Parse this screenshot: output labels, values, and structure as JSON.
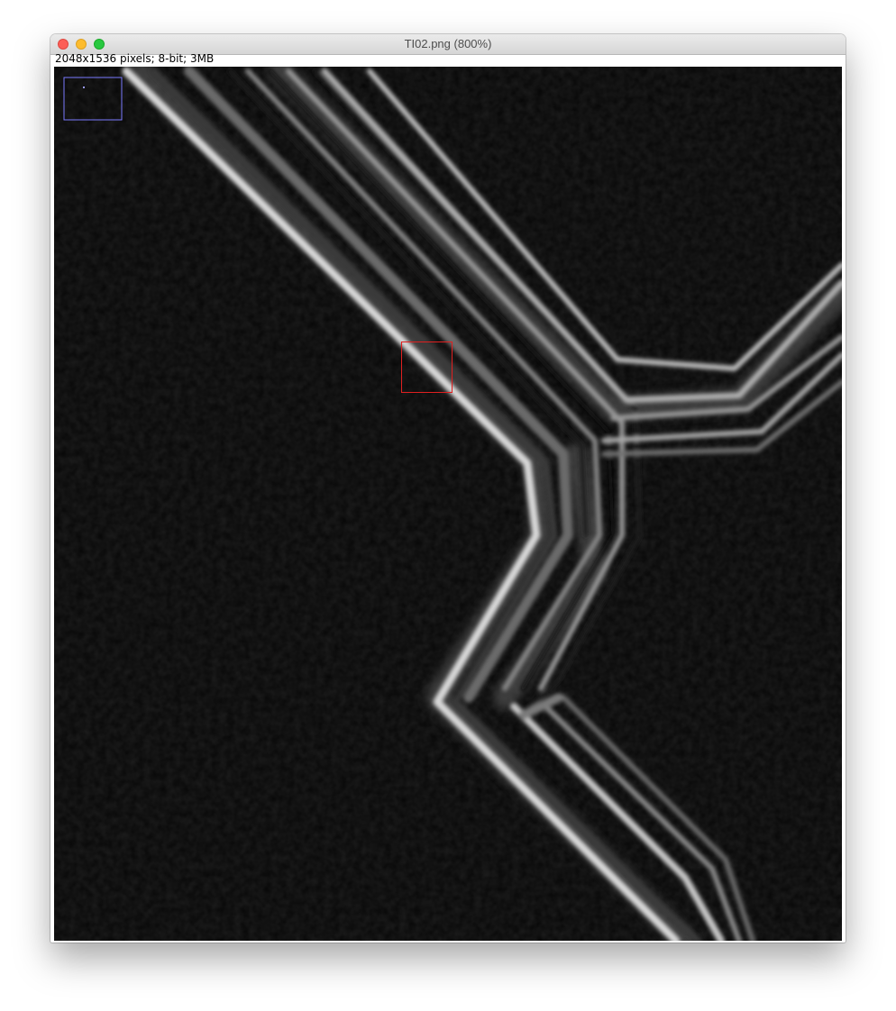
{
  "window": {
    "title": "TI02.png (800%)",
    "info": "2048x1536 pixels; 8-bit; 3MB"
  },
  "overlays": {
    "navigator_color": "#7a7aff",
    "roi_color": "#e02020"
  }
}
